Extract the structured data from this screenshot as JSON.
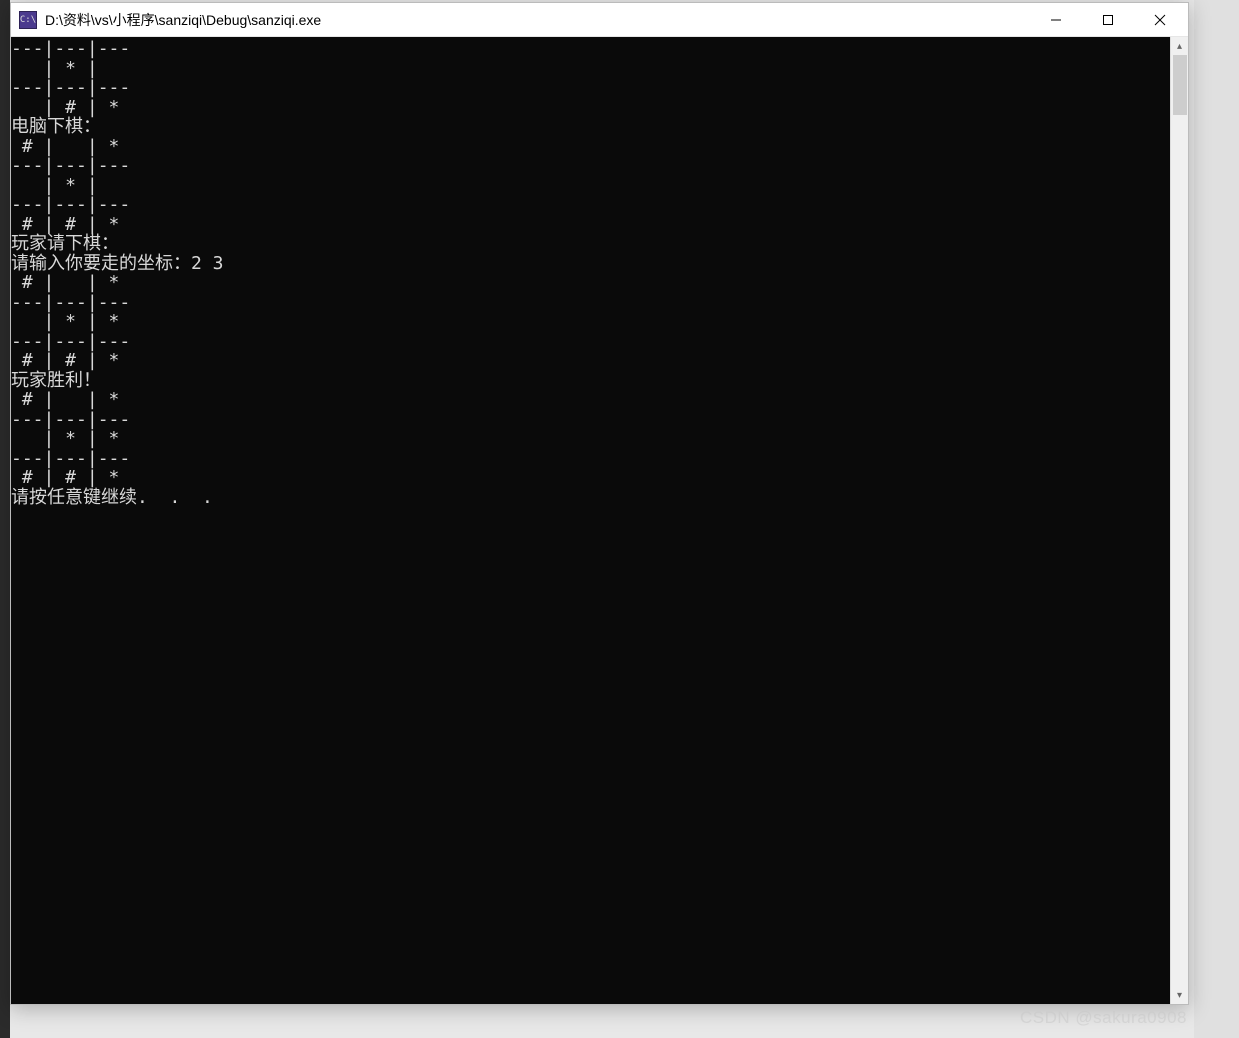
{
  "window": {
    "title": "D:\\资料\\vs\\小程序\\sanziqi\\Debug\\sanziqi.exe",
    "icon_label": "C:\\"
  },
  "titlebar_controls": {
    "minimize": "minimize",
    "maximize": "maximize",
    "close": "close"
  },
  "console_lines": [
    "---|---|---",
    "   | * |   ",
    "---|---|---",
    "   | # | * ",
    "电脑下棋：",
    " # |   | * ",
    "---|---|---",
    "   | * |   ",
    "---|---|---",
    " # | # | * ",
    "玩家请下棋：",
    "请输入你要走的坐标：2 3",
    " # |   | * ",
    "---|---|---",
    "   | * | * ",
    "---|---|---",
    " # | # | * ",
    "玩家胜利！",
    " # |   | * ",
    "---|---|---",
    "   | * | * ",
    "---|---|---",
    " # | # | * ",
    "请按任意键继续.  .  ."
  ],
  "watermark": "CSDN @sakura0908"
}
